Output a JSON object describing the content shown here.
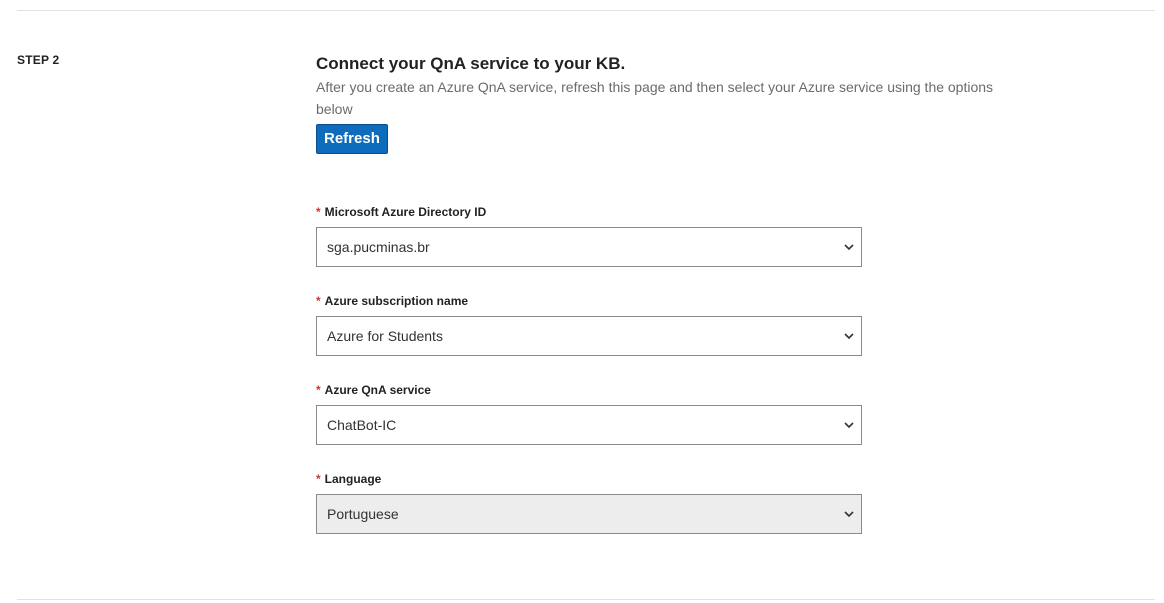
{
  "step": {
    "label": "STEP 2"
  },
  "section": {
    "title": "Connect your QnA service to your KB.",
    "description": "After you create an Azure QnA service, refresh this page and then select your Azure service using the options below",
    "refresh_label": "Refresh"
  },
  "fields": [
    {
      "required_mark": "*",
      "label": "Microsoft Azure Directory ID",
      "value": "sga.pucminas.br",
      "disabled": false
    },
    {
      "required_mark": "*",
      "label": "Azure subscription name",
      "value": "Azure for Students",
      "disabled": false
    },
    {
      "required_mark": "*",
      "label": "Azure QnA service",
      "value": "ChatBot-IC",
      "disabled": false
    },
    {
      "required_mark": "*",
      "label": "Language",
      "value": "Portuguese",
      "disabled": true
    }
  ],
  "colors": {
    "accent": "#0f6cbd",
    "required": "#d13438",
    "disabled_bg": "#ededed"
  }
}
